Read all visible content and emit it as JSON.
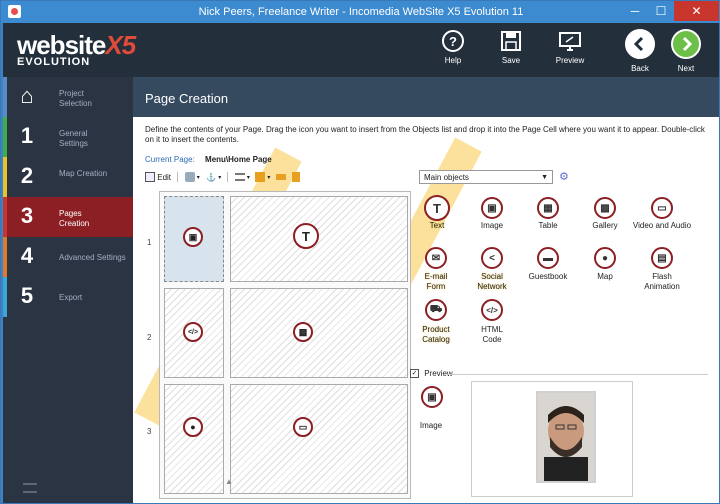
{
  "window": {
    "title": "Nick Peers, Freelance Writer - Incomedia WebSite X5 Evolution 11",
    "min": "─",
    "max": "☐",
    "close": "✕"
  },
  "logo": {
    "brand": "website",
    "version": "X5",
    "edition": "EVOLUTION"
  },
  "toolbar": {
    "help": "Help",
    "save": "Save",
    "preview": "Preview",
    "back": "Back",
    "next": "Next"
  },
  "sidebar": {
    "items": [
      {
        "num": "⌂",
        "label": "Project Selection",
        "color": "#5b8ac4"
      },
      {
        "num": "1",
        "label": "General Settings",
        "color": "#3fae4a"
      },
      {
        "num": "2",
        "label": "Map Creation",
        "color": "#e8c428"
      },
      {
        "num": "3",
        "label": "Pages Creation",
        "color": "#c7352c"
      },
      {
        "num": "4",
        "label": "Advanced Settings",
        "color": "#e07a2a"
      },
      {
        "num": "5",
        "label": "Export",
        "color": "#3aa6d8"
      }
    ]
  },
  "main": {
    "header": "Page Creation",
    "description": "Define the contents of your Page. Drag the icon you want to insert from the Objects list and drop it into the Page Cell where you want it to appear. Double-click on it to insert the contents.",
    "current_page_label": "Current Page:",
    "current_page": "Menu\\Home Page",
    "edit": "Edit",
    "rows": [
      "1",
      "2",
      "3"
    ]
  },
  "objects": {
    "dropdown": "Main objects",
    "items": [
      {
        "label": "Text",
        "glyph": "T"
      },
      {
        "label": "Image",
        "glyph": "▣"
      },
      {
        "label": "Table",
        "glyph": "▦"
      },
      {
        "label": "Gallery",
        "glyph": "▩"
      },
      {
        "label": "Video and Audio",
        "glyph": "▭"
      },
      {
        "label": "E-mail Form",
        "glyph": "✉"
      },
      {
        "label": "Social Network",
        "glyph": "<"
      },
      {
        "label": "Guestbook",
        "glyph": "▬"
      },
      {
        "label": "Map",
        "glyph": "●"
      },
      {
        "label": "Flash Animation",
        "glyph": "▤"
      },
      {
        "label": "Product Catalog",
        "glyph": "⛟"
      },
      {
        "label": "HTML Code",
        "glyph": "</>"
      }
    ]
  },
  "preview": {
    "label": "Preview",
    "checked": "✓",
    "object": "Image"
  }
}
